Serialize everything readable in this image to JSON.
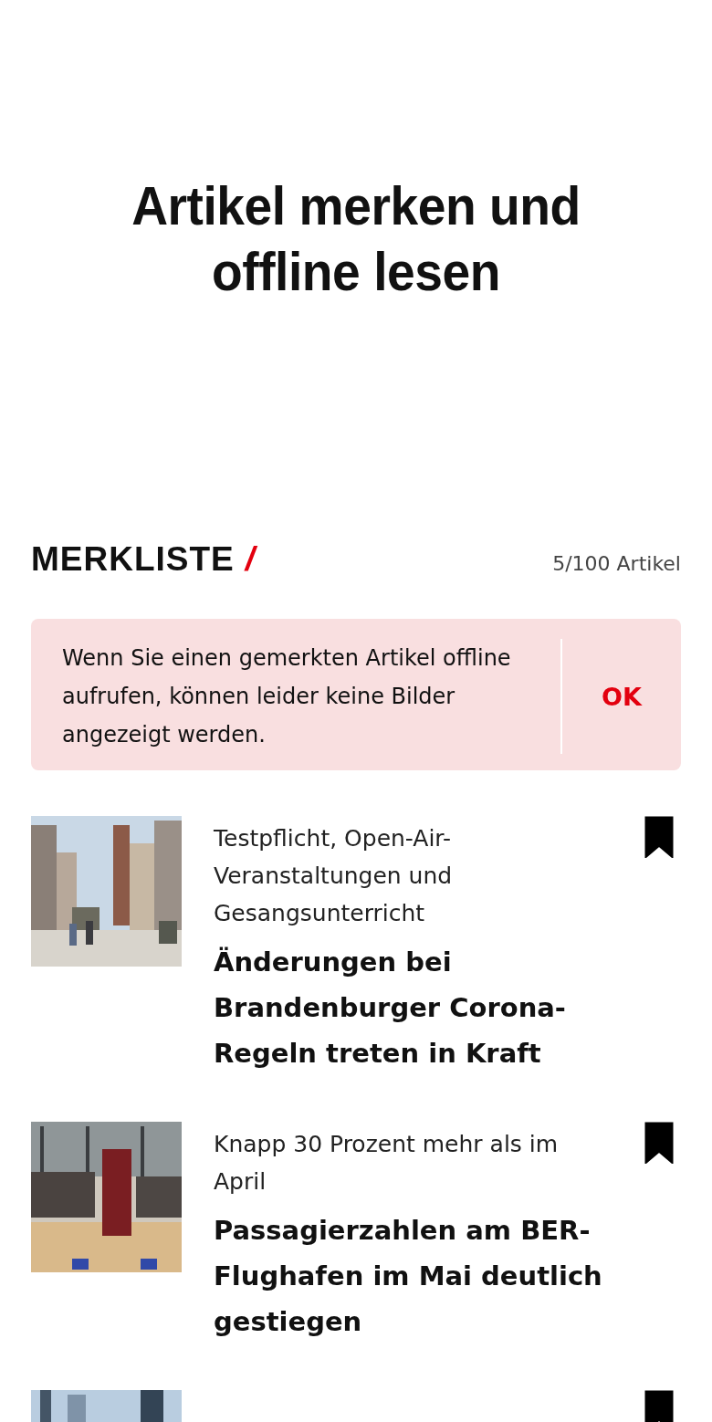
{
  "headline": "Artikel merken und offline lesen",
  "section": {
    "title": "MERKLISTE",
    "slash": "/",
    "count": "5/100 Artikel"
  },
  "notice": {
    "text": "Wenn Sie einen gemerkten Artikel offline aufrufen, können leider keine Bilder angezeigt werden.",
    "button": "OK"
  },
  "articles": [
    {
      "kicker": "Testpflicht, Open-Air-Veranstaltungen und Gesangsunterricht",
      "title": "Änderungen bei Brandenburger Corona-Regeln treten in Kraft",
      "bookmarked": true
    },
    {
      "kicker": "Knapp 30 Prozent mehr als im April",
      "title": "Passagierzahlen am BER-Flughafen im Mai deutlich gestiegen",
      "bookmarked": true
    },
    {
      "bookmarked": true
    }
  ]
}
